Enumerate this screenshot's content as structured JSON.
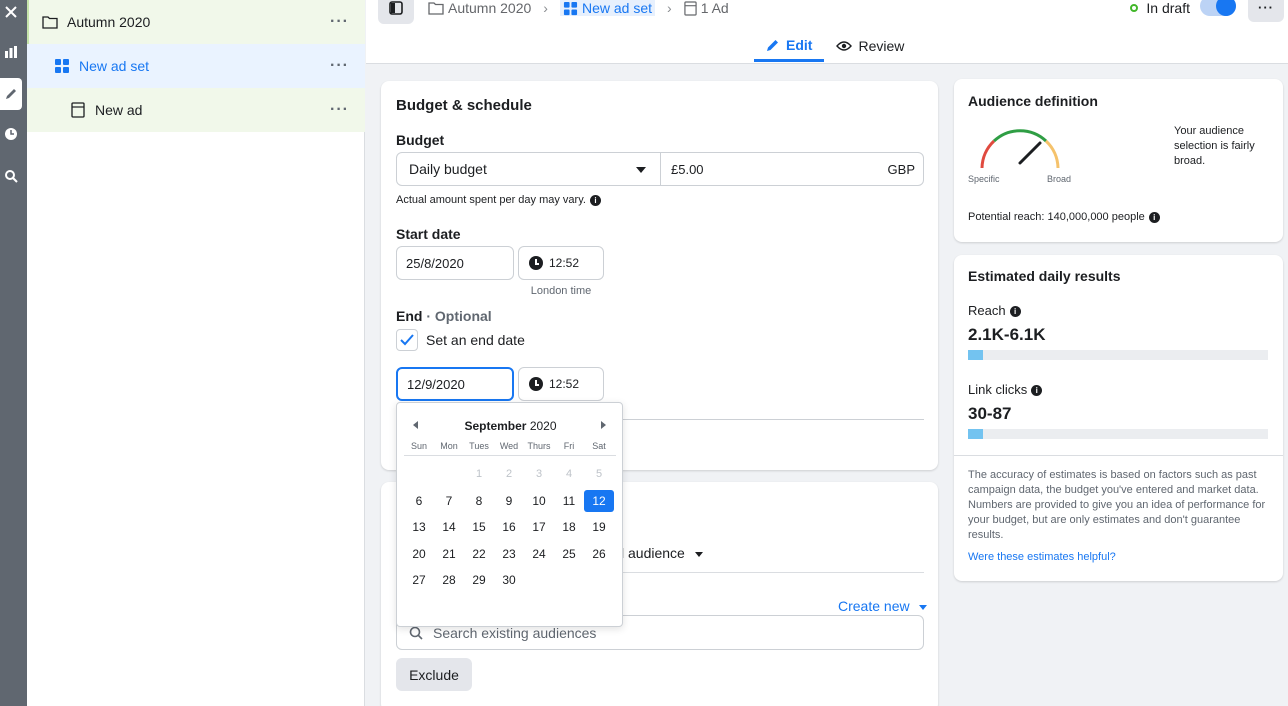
{
  "tree": {
    "campaign": "Autumn 2020",
    "ad_set": "New ad set",
    "ad": "New ad",
    "more": "···"
  },
  "topbar": {
    "breadcrumb": [
      "Autumn 2020",
      "New ad set",
      "1 Ad"
    ],
    "status": "In draft",
    "tabs": [
      "Edit",
      "Review"
    ],
    "more": "···",
    "toggle_on": true
  },
  "budget": {
    "title": "Budget & schedule",
    "budget_label": "Budget",
    "budget_type": "Daily budget",
    "amount": "£5.00",
    "currency": "GBP",
    "note": "Actual amount spent per day may vary.",
    "start_label": "Start date",
    "start_date": "25/8/2020",
    "start_time": "12:52",
    "timezone": "London time",
    "end_label": "End",
    "end_optional": "· Optional",
    "end_checkbox": "Set an end date",
    "end_checked": true,
    "end_date": "12/9/2020",
    "end_time": "12:52"
  },
  "calendar": {
    "month": "September",
    "year": "2020",
    "weekdays": [
      "Sun",
      "Mon",
      "Tues",
      "Wed",
      "Thurs",
      "Fri",
      "Sat"
    ],
    "selected": 12,
    "leading_blanks": 2,
    "days_in_month": 30,
    "disabled_through": 5
  },
  "audience_section": {
    "audience_dropdown_partial": "l audience",
    "create_new": "Create new",
    "search_placeholder": "Search existing audiences",
    "exclude": "Exclude"
  },
  "audience_definition": {
    "title": "Audience definition",
    "gauge_specific": "Specific",
    "gauge_broad": "Broad",
    "description": "Your audience selection is fairly broad.",
    "potential_reach_label": "Potential reach:",
    "potential_reach_value": "140,000,000 people"
  },
  "estimates": {
    "title": "Estimated daily results",
    "reach_label": "Reach",
    "reach_value": "2.1K-6.1K",
    "reach_fill": 0.05,
    "clicks_label": "Link clicks",
    "clicks_value": "30-87",
    "clicks_fill": 0.05,
    "disclaimer": "The accuracy of estimates is based on factors such as past campaign data, the budget you've entered and market data. Numbers are provided to give you an idea of performance for your budget, but are only estimates and don't guarantee results.",
    "feedback_link": "Were these estimates helpful?"
  },
  "colors": {
    "accent": "#1877f2",
    "reach_bar": "#73c3f0",
    "status_dot": "#42b72a"
  }
}
